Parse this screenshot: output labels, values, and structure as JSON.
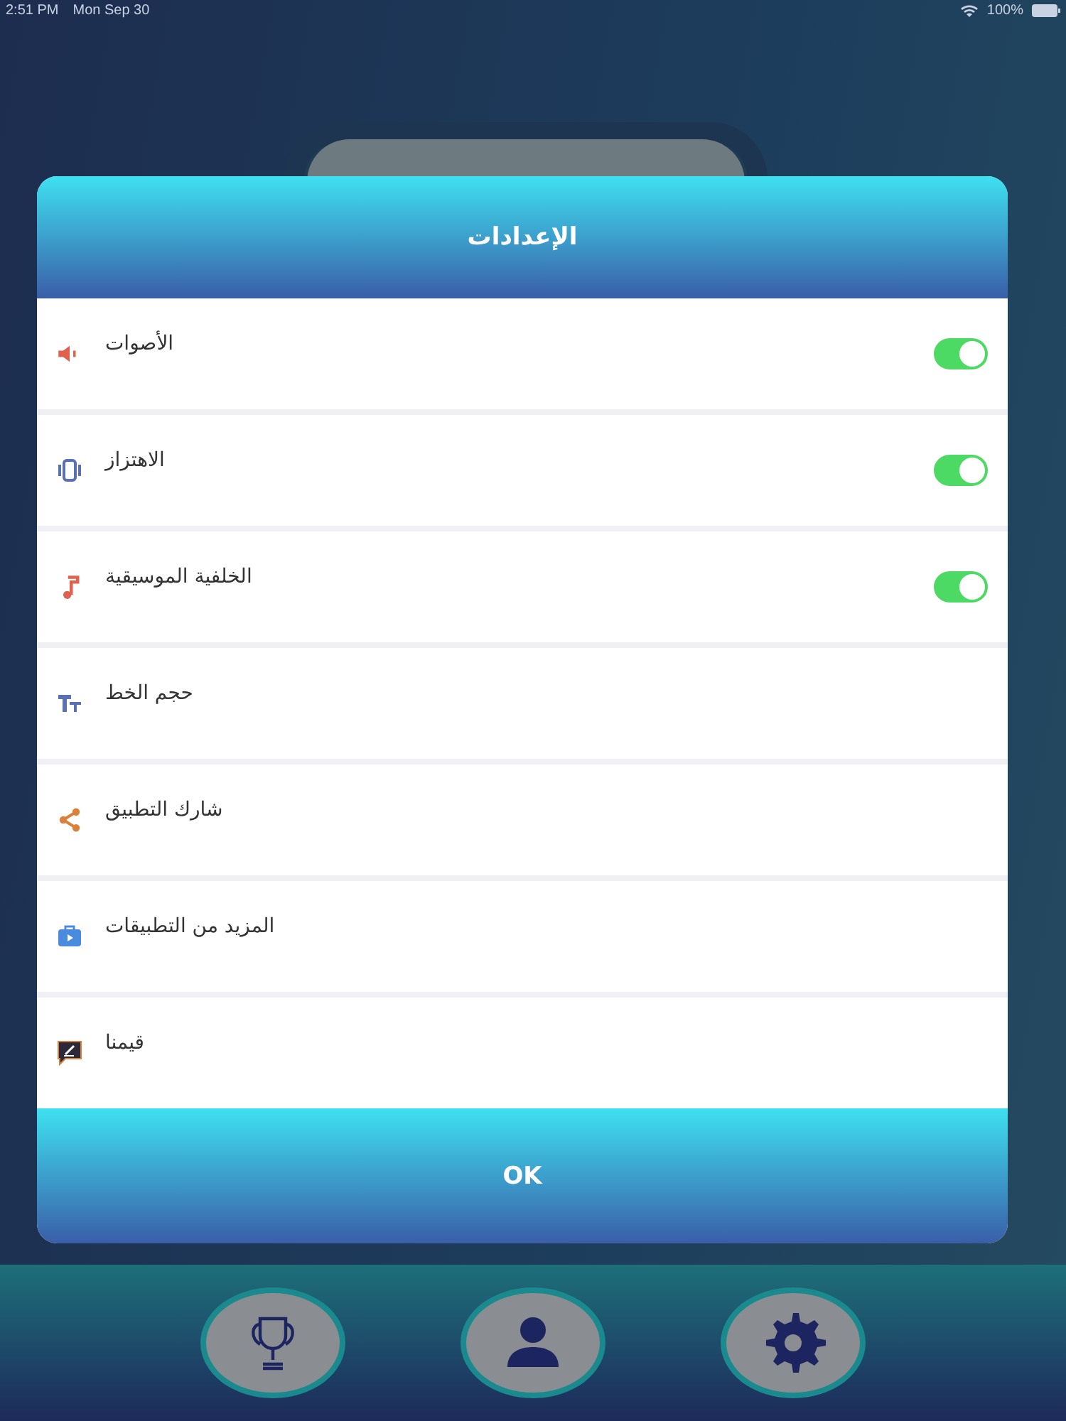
{
  "status_bar": {
    "time": "2:51 PM",
    "date": "Mon Sep 30",
    "battery": "100%"
  },
  "dialog": {
    "title": "الإعدادات",
    "ok": "OK",
    "rows": [
      {
        "kind": "toggle",
        "label": "الأصوات",
        "on": true
      },
      {
        "kind": "toggle",
        "label": "الاهتزاز",
        "on": true
      },
      {
        "kind": "toggle",
        "label": "الخلفية الموسيقية",
        "on": true
      },
      {
        "kind": "link",
        "label": "حجم الخط"
      },
      {
        "kind": "link",
        "label": "شارك التطبيق"
      },
      {
        "kind": "link",
        "label": "المزيد من التطبيقات"
      },
      {
        "kind": "link",
        "label": "قيمنا"
      }
    ]
  }
}
